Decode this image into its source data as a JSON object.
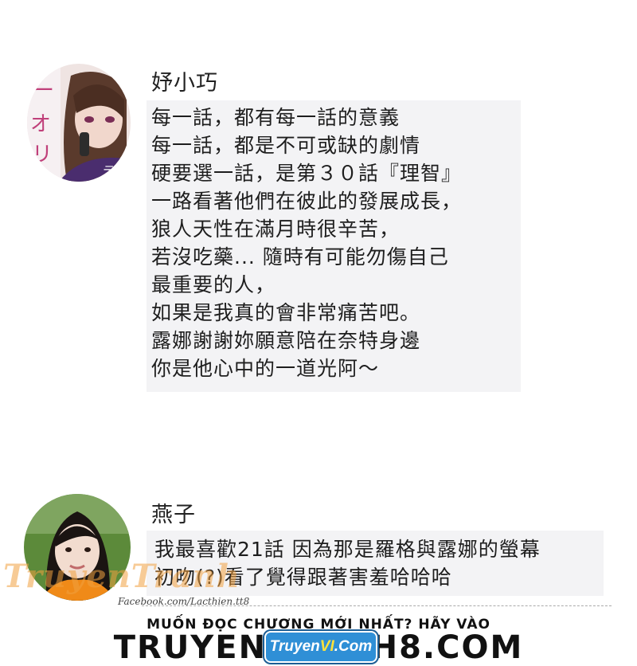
{
  "comments": [
    {
      "name": "妤小巧",
      "lines": [
        "每一話，都有每一話的意義",
        "每一話，都是不可或缺的劇情",
        "硬要選一話，是第３０話『理智』",
        "一路看著他們在彼此的發展成長，",
        "狼人天性在滿月時很辛苦，",
        "若沒吃藥... 隨時有可能勿傷自己",
        "最重要的人，",
        "如果是我真的會非常痛苦吧。",
        "露娜謝謝妳願意陪在奈特身邊",
        "你是他心中的一道光阿～"
      ]
    },
    {
      "name": "燕子",
      "lines": [
        "我最喜歡21話 因為那是羅格與露娜的螢幕",
        "初吻(?)看了覺得跟著害羞哈哈哈"
      ]
    }
  ],
  "watermark": {
    "brand": "TruyenTranh",
    "facebook": "Facebook.com/Lacthien.tt8"
  },
  "promo": {
    "top_text": "MUỐN ĐỌC CHƯƠNG MỚI NHẤT? HÃY VÀO",
    "site_text": "TRUYENTRANH8.COM",
    "logo_prefix": "Truyen",
    "logo_vi": "VI",
    "logo_suffix": ".Com"
  },
  "colors": {
    "bubble_bg": "#f3f3f5",
    "logo_blue": "#2f8fd6",
    "logo_yellow": "#ffe23a",
    "watermark_orange": "#f0a040"
  }
}
